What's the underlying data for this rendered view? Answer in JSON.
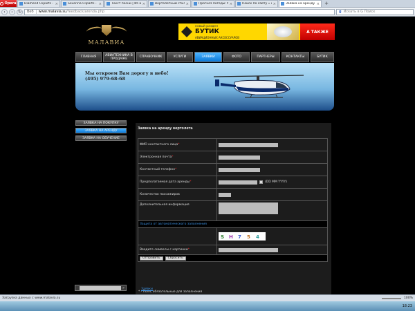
{
  "browser": {
    "menu_label": "Opera",
    "tabs": [
      {
        "title": "Diamond Cliparts - Sp...",
        "active": false
      },
      {
        "title": "Severina Cliparts - Саи...",
        "active": false
      },
      {
        "title": "Текст песни | Из а'ф ...",
        "active": false
      },
      {
        "title": "Вертолетный стиль: со...",
        "active": false
      },
      {
        "title": "Прогноз погоды: Мос...",
        "active": false
      },
      {
        "title": "Поиск по сайту « ALL...",
        "active": false
      },
      {
        "title": "Заявка на аренду",
        "active": true
      }
    ],
    "address_label": "Веб",
    "url_host": "www.malavia.su",
    "url_path": "/feedback/arenda.php",
    "search_placeholder": "Искать в G Поиск"
  },
  "site": {
    "logo_text": "МАЛАВИА",
    "banner": {
      "new_label": "новый раздел",
      "title": "БУТИК",
      "subtitle": "АВИАЦИОННЫХ АКСЕССУАРОВ",
      "cta": "А ТАКЖЕ"
    },
    "menu": [
      {
        "label": "ГЛАВНАЯ",
        "active": false
      },
      {
        "label": "АВИАТЕХНИКА В ПРОДАЖЕ",
        "active": false
      },
      {
        "label": "СПРАВОЧНИК",
        "active": false
      },
      {
        "label": "УСЛУГИ",
        "active": false
      },
      {
        "label": "ЗАЯВКИ",
        "active": true
      },
      {
        "label": "ФОТО",
        "active": false
      },
      {
        "label": "ПАРТНЕРЫ",
        "active": false
      },
      {
        "label": "КОНТАКТЫ",
        "active": false
      },
      {
        "label": "БУТИК",
        "active": false
      }
    ],
    "hero": {
      "line1": "Мы откроем Вам дорогу в небо!",
      "line2": "(495) 979-68-68"
    },
    "sidebar": [
      {
        "label": "ЗАЯВКА НА ПОКУПКУ",
        "active": false
      },
      {
        "label": "ЗАЯВКА НА АРЕНДУ",
        "active": true
      },
      {
        "label": "ЗАЯВКА НА ОБУЧЕНИЕ",
        "active": false
      }
    ],
    "form": {
      "title": "Заявка на аренду вертолета",
      "fields": {
        "name_label": "ФИО контактного лица",
        "email_label": "Электронная почта",
        "phone_label": "Контактный телефон",
        "date_label": "Предполагаемая дата аренды",
        "date_hint": "(DD MM YYYY)",
        "passengers_label": "Количество пассажиров",
        "info_label": "Дополнительная информация",
        "captcha_link": "Защита от автоматического заполнения",
        "captcha_text": "S H 7 5 4",
        "captcha_input_label": "Введите символы с картинки"
      },
      "required_mark": "*",
      "submit_label": "Отправить",
      "reset_label": "Сбросить",
      "footnote": "* - Поля, обязательные для заполнения"
    },
    "breadcrumb": "Заявки"
  },
  "status": {
    "text": "Загрузка данных с www.malavia.su",
    "zoom": "100%",
    "clock": "18:23"
  },
  "colors": {
    "accent": "#0a78d6",
    "banner": "#ffd700",
    "required": "#e33333"
  }
}
